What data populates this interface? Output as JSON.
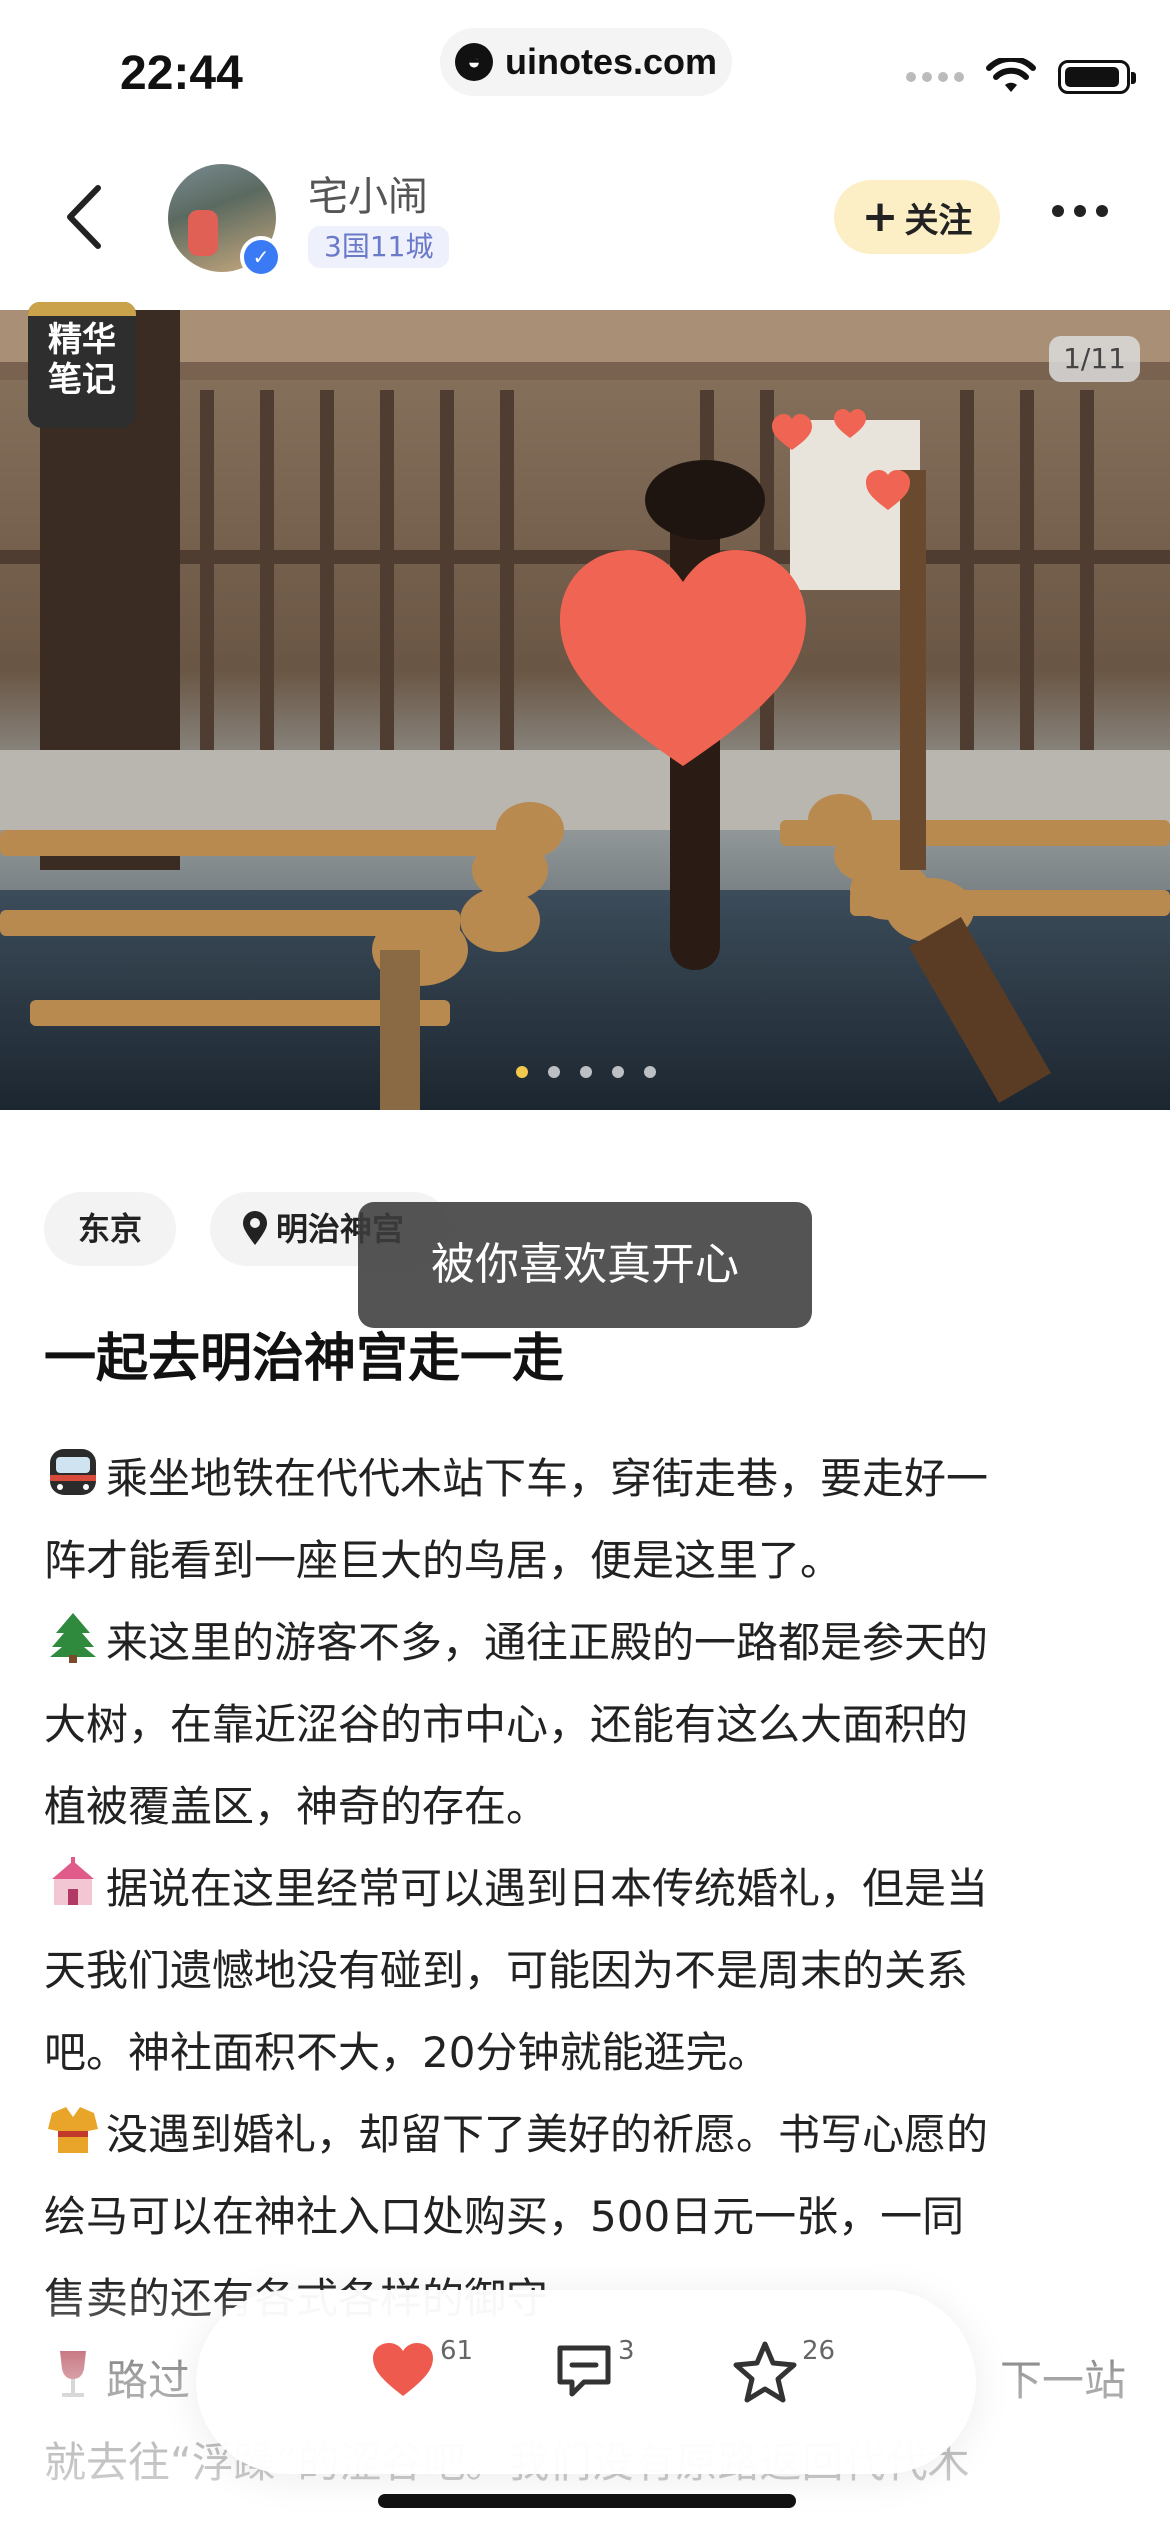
{
  "status_bar": {
    "time": "22:44",
    "url": "uinotes.com"
  },
  "header": {
    "username": "宅小闹",
    "user_level": "3国11城",
    "follow_label": "关注"
  },
  "photo": {
    "badge": [
      "精华",
      "笔记"
    ],
    "counter": "1/11",
    "dots_total": 5,
    "active_dot": 0
  },
  "tags": {
    "city": "东京",
    "location": "明治神宫"
  },
  "toast": "被你喜欢真开心",
  "post": {
    "title": "一起去明治神宫走一走",
    "lines": [
      "乘坐地铁在代代木站下车，穿街走巷，要走好一",
      "阵才能看到一座巨大的鸟居，便是这里了。",
      "来这里的游客不多，通往正殿的一路都是参天的",
      "大树，在靠近涩谷的市中心，还能有这么大面积的",
      "植被覆盖区，神奇的存在。",
      "据说在这里经常可以遇到日本传统婚礼，但是当",
      "天我们遗憾地没有碰到，可能因为不是周末的关系",
      "吧。神社面积不大，20分钟就能逛完。",
      "没遇到婚礼，却留下了美好的祈愿。书写心愿的",
      "绘马可以在神社入口处购买，500日元一张，一同",
      "售卖的还有各式各样的御守",
      "路过",
      "下一站",
      "就去往“浮躁”的涩谷吧。我们没有原路返回代代木"
    ]
  },
  "actions": {
    "like_count": "61",
    "comment_count": "3",
    "star_count": "26"
  },
  "icons": {
    "back": "chevron-left-icon",
    "more": "more-dots-icon",
    "like": "heart-icon",
    "comment": "comment-icon",
    "star": "star-icon",
    "location": "location-pin-icon"
  },
  "colors": {
    "like_red": "#ef5a4f",
    "follow_bg": "#fcefc6",
    "level_text": "#6b79c9"
  }
}
